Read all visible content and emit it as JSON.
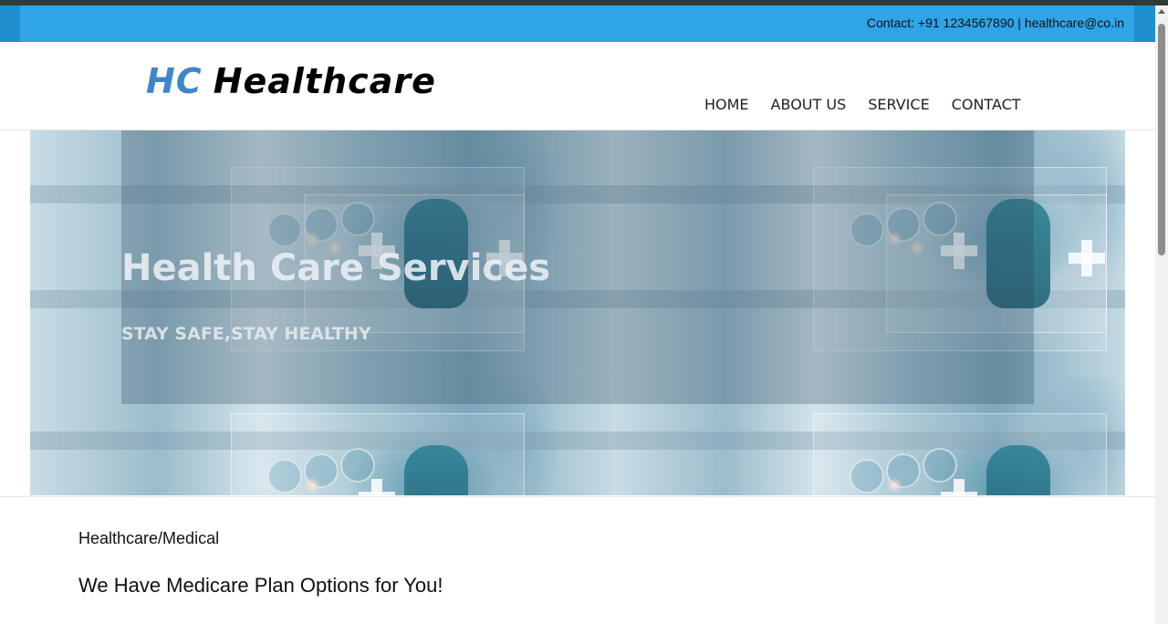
{
  "contact_bar": {
    "text": "Contact: +91 1234567890 | healthcare@co.in"
  },
  "logo": {
    "mark": "HC",
    "word": "Healthcare"
  },
  "nav": {
    "items": [
      "HOME",
      "ABOUT US",
      "SERVICE",
      "CONTACT"
    ]
  },
  "hero": {
    "title": "Health Care Services",
    "subtitle": "STAY SAFE,STAY HEALTHY"
  },
  "content": {
    "category": "Healthcare/Medical",
    "headline": "We Have Medicare Plan Options for You!"
  },
  "colors": {
    "contact_bar": "#2fa4e7",
    "logo_mark": "#3f86c9",
    "logo_word": "#000000"
  },
  "scrollbar": {
    "position_fraction": 0.0
  }
}
